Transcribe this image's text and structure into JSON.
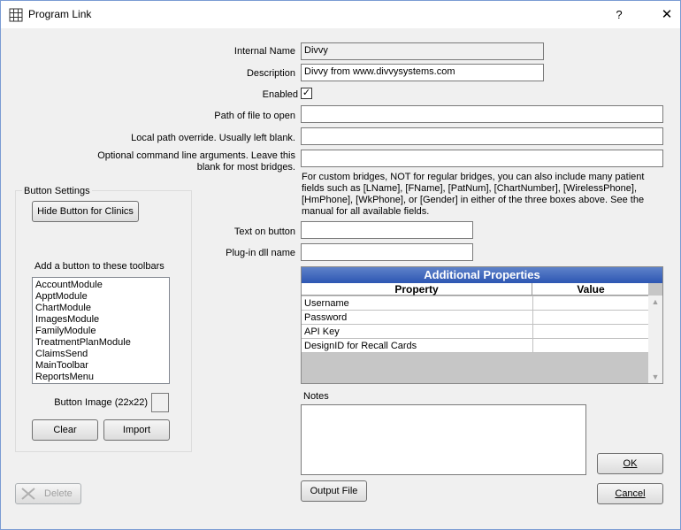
{
  "window": {
    "title": "Program Link",
    "help_label": "?",
    "close_label": "✕"
  },
  "fields": {
    "internal_name_label": "Internal Name",
    "internal_name_value": "Divvy",
    "description_label": "Description",
    "description_value": "Divvy from www.divvysystems.com",
    "enabled_label": "Enabled",
    "enabled_check": "✓",
    "path_label": "Path of file to open",
    "path_value": "",
    "local_path_label": "Local path override.  Usually left blank.",
    "local_path_value": "",
    "cmd_label_line1": "Optional command line arguments.  Leave this",
    "cmd_label_line2": "blank for most bridges.",
    "cmd_value": "",
    "bridge_note": "For custom bridges, NOT for regular bridges, you can also include many patient fields such as [LName], [FName], [PatNum], [ChartNumber], [WirelessPhone], [HmPhone], [WkPhone], or [Gender] in either of the three boxes above. See the manual for all available fields.",
    "text_on_button_label": "Text on button",
    "text_on_button_value": "",
    "plugin_label": "Plug-in dll name",
    "plugin_value": ""
  },
  "button_settings": {
    "title": "Button Settings",
    "hide_button_label": "Hide Button for Clinics",
    "toolbars_label": "Add a button to these toolbars",
    "toolbars": [
      "AccountModule",
      "ApptModule",
      "ChartModule",
      "ImagesModule",
      "FamilyModule",
      "TreatmentPlanModule",
      "ClaimsSend",
      "MainToolbar",
      "ReportsMenu"
    ],
    "button_image_label": "Button Image (22x22)",
    "clear_label": "Clear",
    "import_label": "Import"
  },
  "properties": {
    "title": "Additional Properties",
    "col_property": "Property",
    "col_value": "Value",
    "rows": [
      {
        "property": "Username",
        "value": ""
      },
      {
        "property": "Password",
        "value": ""
      },
      {
        "property": "API Key",
        "value": ""
      },
      {
        "property": "DesignID for Recall Cards",
        "value": ""
      }
    ]
  },
  "notes": {
    "label": "Notes",
    "value": ""
  },
  "actions": {
    "delete_label": "Delete",
    "output_file_label": "Output File",
    "ok_label": "OK",
    "cancel_label": "Cancel"
  }
}
